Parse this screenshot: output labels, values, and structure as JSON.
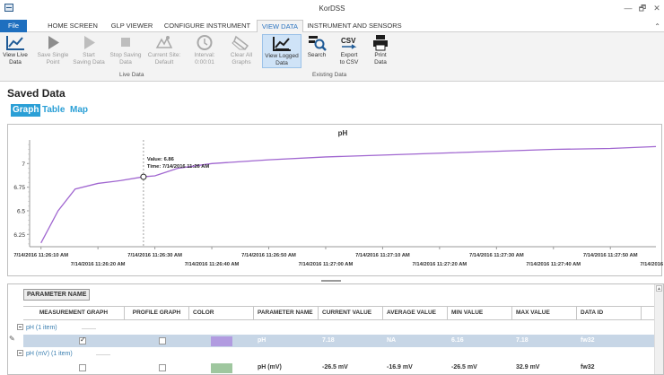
{
  "window": {
    "title": "KorDSS",
    "minimize": "—",
    "restore": "🗗",
    "close": "✕"
  },
  "tabs": [
    {
      "label": "File"
    },
    {
      "label": "HOME SCREEN"
    },
    {
      "label": "GLP VIEWER"
    },
    {
      "label": "CONFIGURE INSTRUMENT"
    },
    {
      "label": "VIEW DATA"
    },
    {
      "label": "INSTRUMENT AND SENSORS"
    }
  ],
  "ribbon": {
    "collapse": "⌃",
    "buttons": [
      {
        "label": "View Live Data",
        "l1": "View Live",
        "l2": "Data",
        "icon": "line-chart-icon",
        "disabled": false
      },
      {
        "l1": "Save Single",
        "l2": "Point",
        "icon": "play-icon",
        "disabled": true
      },
      {
        "l1": "Start",
        "l2": "Saving Data",
        "icon": "play-icon",
        "disabled": true
      },
      {
        "l1": "Stop Saving",
        "l2": "Data",
        "icon": "stop-icon",
        "disabled": true
      },
      {
        "l1": "Current Site:",
        "l2": "Default",
        "icon": "site-icon",
        "disabled": true
      },
      {
        "l1": "Interval:",
        "l2": "0:00:01",
        "icon": "clock-icon",
        "disabled": true
      },
      {
        "l1": "Clear All",
        "l2": "Graphs",
        "icon": "eraser-icon",
        "disabled": true
      },
      {
        "l1": "View Logged",
        "l2": "Data",
        "icon": "logged-chart-icon",
        "disabled": false
      },
      {
        "l1": "Search",
        "l2": "",
        "icon": "search-icon",
        "disabled": false
      },
      {
        "l1": "Export",
        "l2": "to CSV",
        "icon": "csv-icon",
        "disabled": false
      },
      {
        "l1": "Print",
        "l2": "Data",
        "icon": "printer-icon",
        "disabled": false
      }
    ],
    "groups": {
      "live": "Live Data",
      "existing": "Existing Data"
    }
  },
  "saved": {
    "title": "Saved Data",
    "view_tabs": [
      "Graph",
      "Table",
      "Map"
    ]
  },
  "chart_data": {
    "type": "line",
    "title": "pH",
    "xlabel": "",
    "ylabel": "",
    "y_ticks": [
      "7",
      "6.75",
      "6.5",
      "6.25"
    ],
    "ylim": [
      6.12,
      7.25
    ],
    "x_ticks_top": [
      "7/14/2016 11:26:10 AM",
      "7/14/2016 11:26:30 AM",
      "7/14/2016 11:26:50 AM",
      "7/14/2016 11:27:10 AM",
      "7/14/2016 11:27:30 AM",
      "7/14/2016 11:27:50 AM"
    ],
    "x_ticks_bottom": [
      "7/14/2016 11:26:20 AM",
      "7/14/2016 11:26:40 AM",
      "7/14/2016 11:27:00 AM",
      "7/14/2016 11:27:20 AM",
      "7/14/2016 11:27:40 AM",
      "7/14/2016 11:28:00 AM"
    ],
    "x_start_seconds": 8,
    "x_end_seconds": 118,
    "series": [
      {
        "color": "#a066d0",
        "x": [
          10,
          13,
          16,
          20,
          24,
          28,
          30,
          34,
          40,
          50,
          60,
          70,
          80,
          90,
          100,
          110,
          120
        ],
        "y": [
          6.16,
          6.5,
          6.73,
          6.79,
          6.82,
          6.86,
          6.87,
          6.95,
          7.0,
          7.04,
          7.07,
          7.09,
          7.11,
          7.13,
          7.15,
          7.16,
          7.18
        ]
      }
    ],
    "tooltip": {
      "value": "Value: 6.86",
      "time": "Time: 7/14/2016 11:26 AM",
      "x": 28,
      "y": 6.86
    }
  },
  "grid": {
    "param_button": "PARAMETER NAME",
    "columns": [
      "MEASUREMENT GRAPH",
      "PROFILE GRAPH",
      "COLOR",
      "PARAMETER NAME",
      "CURRENT VALUE",
      "AVERAGE VALUE",
      "MIN VALUE",
      "MAX VALUE",
      "DATA ID"
    ],
    "groups": [
      {
        "label": "pH (1 item)",
        "row": {
          "measurement": true,
          "profile": false,
          "color": "#b19be0",
          "name": "pH",
          "current": "7.18",
          "average": "NA",
          "min": "6.16",
          "max": "7.18",
          "id": "fw32",
          "selected": true
        }
      },
      {
        "label": "pH (mV) (1 item)",
        "row": {
          "measurement": false,
          "profile": false,
          "color": "#9fc79f",
          "name": "pH (mV)",
          "current": "-26.5 mV",
          "average": "-16.9 mV",
          "min": "-26.5 mV",
          "max": "32.9 mV",
          "id": "fw32",
          "selected": false
        }
      }
    ]
  }
}
